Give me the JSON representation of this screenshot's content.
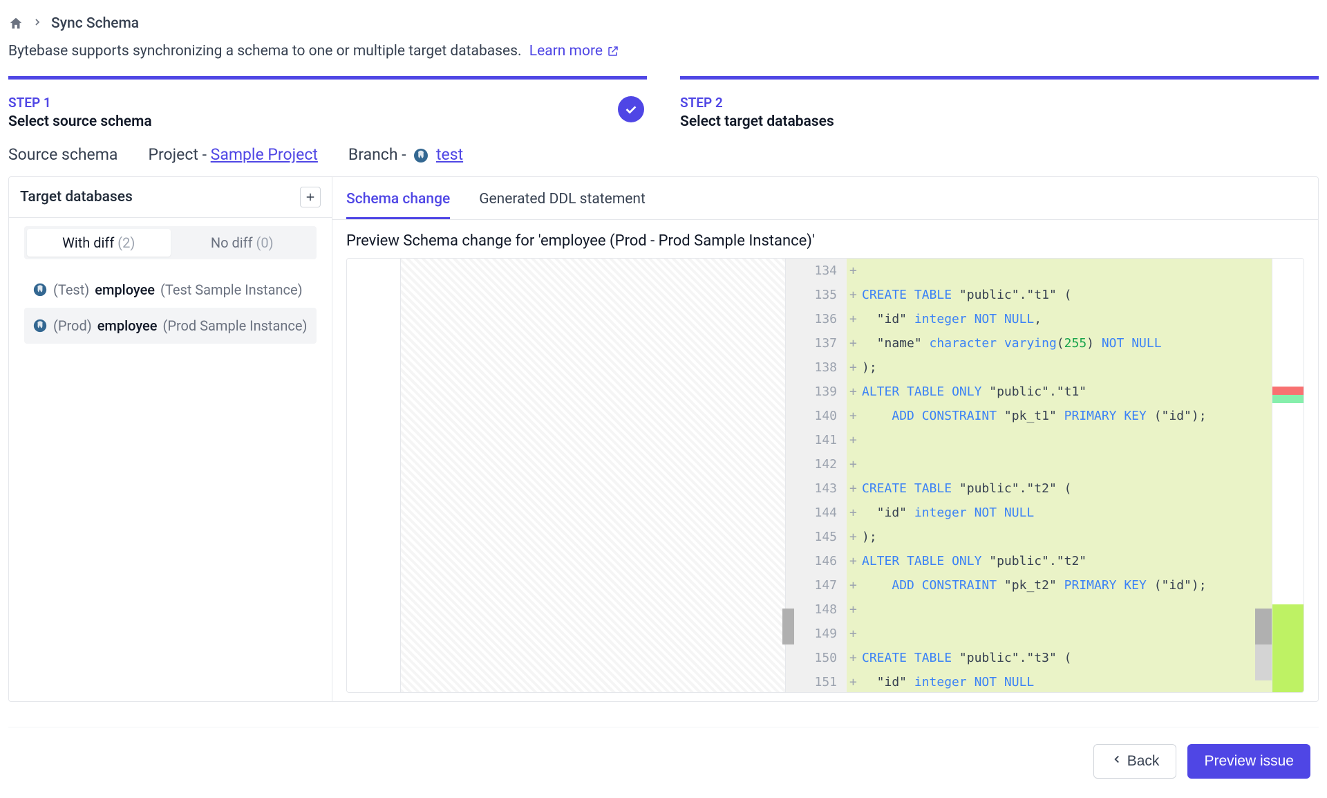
{
  "breadcrumb": {
    "current": "Sync Schema"
  },
  "description": {
    "text": "Bytebase supports synchronizing a schema to one or multiple target databases.",
    "learn_more_label": "Learn more"
  },
  "steps": {
    "step1": {
      "num": "STEP 1",
      "title": "Select source schema",
      "completed": true
    },
    "step2": {
      "num": "STEP 2",
      "title": "Select target databases"
    }
  },
  "source_row": {
    "source_schema_label": "Source schema",
    "project_label": "Project - ",
    "project_name": "Sample Project",
    "branch_label": "Branch - ",
    "branch_name": "test"
  },
  "left_panel": {
    "header": "Target databases",
    "with_diff_label": "With diff",
    "with_diff_count": "(2)",
    "no_diff_label": "No diff",
    "no_diff_count": "(0)",
    "databases": [
      {
        "env": "(Test)",
        "name": "employee",
        "instance": "(Test Sample Instance)"
      },
      {
        "env": "(Prod)",
        "name": "employee",
        "instance": "(Prod Sample Instance)"
      }
    ]
  },
  "right_panel": {
    "tabs": {
      "schema_change": "Schema change",
      "generated_ddl": "Generated DDL statement"
    },
    "preview_title": "Preview Schema change for 'employee (Prod - Prod Sample Instance)'"
  },
  "diff": {
    "lines": [
      {
        "n": 134,
        "tokens": []
      },
      {
        "n": 135,
        "tokens": [
          {
            "t": "kw",
            "s": "CREATE"
          },
          {
            "t": "txt",
            "s": " "
          },
          {
            "t": "kw",
            "s": "TABLE"
          },
          {
            "t": "txt",
            "s": " \"public\".\"t1\" ("
          }
        ]
      },
      {
        "n": 136,
        "tokens": [
          {
            "t": "txt",
            "s": "  \"id\" "
          },
          {
            "t": "kw",
            "s": "integer"
          },
          {
            "t": "txt",
            "s": " "
          },
          {
            "t": "kw",
            "s": "NOT"
          },
          {
            "t": "txt",
            "s": " "
          },
          {
            "t": "kw",
            "s": "NULL"
          },
          {
            "t": "txt",
            "s": ","
          }
        ]
      },
      {
        "n": 137,
        "tokens": [
          {
            "t": "txt",
            "s": "  \"name\" "
          },
          {
            "t": "kw",
            "s": "character"
          },
          {
            "t": "txt",
            "s": " "
          },
          {
            "t": "kw",
            "s": "varying"
          },
          {
            "t": "txt",
            "s": "("
          },
          {
            "t": "num",
            "s": "255"
          },
          {
            "t": "txt",
            "s": ") "
          },
          {
            "t": "kw",
            "s": "NOT"
          },
          {
            "t": "txt",
            "s": " "
          },
          {
            "t": "kw",
            "s": "NULL"
          }
        ]
      },
      {
        "n": 138,
        "tokens": [
          {
            "t": "txt",
            "s": ");"
          }
        ]
      },
      {
        "n": 139,
        "tokens": [
          {
            "t": "kw",
            "s": "ALTER"
          },
          {
            "t": "txt",
            "s": " "
          },
          {
            "t": "kw",
            "s": "TABLE"
          },
          {
            "t": "txt",
            "s": " "
          },
          {
            "t": "kw",
            "s": "ONLY"
          },
          {
            "t": "txt",
            "s": " \"public\".\"t1\""
          }
        ]
      },
      {
        "n": 140,
        "tokens": [
          {
            "t": "txt",
            "s": "    "
          },
          {
            "t": "kw",
            "s": "ADD"
          },
          {
            "t": "txt",
            "s": " "
          },
          {
            "t": "kw",
            "s": "CONSTRAINT"
          },
          {
            "t": "txt",
            "s": " \"pk_t1\" "
          },
          {
            "t": "kw",
            "s": "PRIMARY"
          },
          {
            "t": "txt",
            "s": " "
          },
          {
            "t": "kw",
            "s": "KEY"
          },
          {
            "t": "txt",
            "s": " (\"id\");"
          }
        ]
      },
      {
        "n": 141,
        "tokens": []
      },
      {
        "n": 142,
        "tokens": []
      },
      {
        "n": 143,
        "tokens": [
          {
            "t": "kw",
            "s": "CREATE"
          },
          {
            "t": "txt",
            "s": " "
          },
          {
            "t": "kw",
            "s": "TABLE"
          },
          {
            "t": "txt",
            "s": " \"public\".\"t2\" ("
          }
        ]
      },
      {
        "n": 144,
        "tokens": [
          {
            "t": "txt",
            "s": "  \"id\" "
          },
          {
            "t": "kw",
            "s": "integer"
          },
          {
            "t": "txt",
            "s": " "
          },
          {
            "t": "kw",
            "s": "NOT"
          },
          {
            "t": "txt",
            "s": " "
          },
          {
            "t": "kw",
            "s": "NULL"
          }
        ]
      },
      {
        "n": 145,
        "tokens": [
          {
            "t": "txt",
            "s": ");"
          }
        ]
      },
      {
        "n": 146,
        "tokens": [
          {
            "t": "kw",
            "s": "ALTER"
          },
          {
            "t": "txt",
            "s": " "
          },
          {
            "t": "kw",
            "s": "TABLE"
          },
          {
            "t": "txt",
            "s": " "
          },
          {
            "t": "kw",
            "s": "ONLY"
          },
          {
            "t": "txt",
            "s": " \"public\".\"t2\""
          }
        ]
      },
      {
        "n": 147,
        "tokens": [
          {
            "t": "txt",
            "s": "    "
          },
          {
            "t": "kw",
            "s": "ADD"
          },
          {
            "t": "txt",
            "s": " "
          },
          {
            "t": "kw",
            "s": "CONSTRAINT"
          },
          {
            "t": "txt",
            "s": " \"pk_t2\" "
          },
          {
            "t": "kw",
            "s": "PRIMARY"
          },
          {
            "t": "txt",
            "s": " "
          },
          {
            "t": "kw",
            "s": "KEY"
          },
          {
            "t": "txt",
            "s": " (\"id\");"
          }
        ]
      },
      {
        "n": 148,
        "tokens": []
      },
      {
        "n": 149,
        "tokens": []
      },
      {
        "n": 150,
        "tokens": [
          {
            "t": "kw",
            "s": "CREATE"
          },
          {
            "t": "txt",
            "s": " "
          },
          {
            "t": "kw",
            "s": "TABLE"
          },
          {
            "t": "txt",
            "s": " \"public\".\"t3\" ("
          }
        ]
      },
      {
        "n": 151,
        "tokens": [
          {
            "t": "txt",
            "s": "  \"id\" "
          },
          {
            "t": "kw",
            "s": "integer"
          },
          {
            "t": "txt",
            "s": " "
          },
          {
            "t": "kw",
            "s": "NOT"
          },
          {
            "t": "txt",
            "s": " "
          },
          {
            "t": "kw",
            "s": "NULL"
          }
        ]
      }
    ]
  },
  "footer": {
    "back_label": "Back",
    "preview_label": "Preview issue"
  }
}
